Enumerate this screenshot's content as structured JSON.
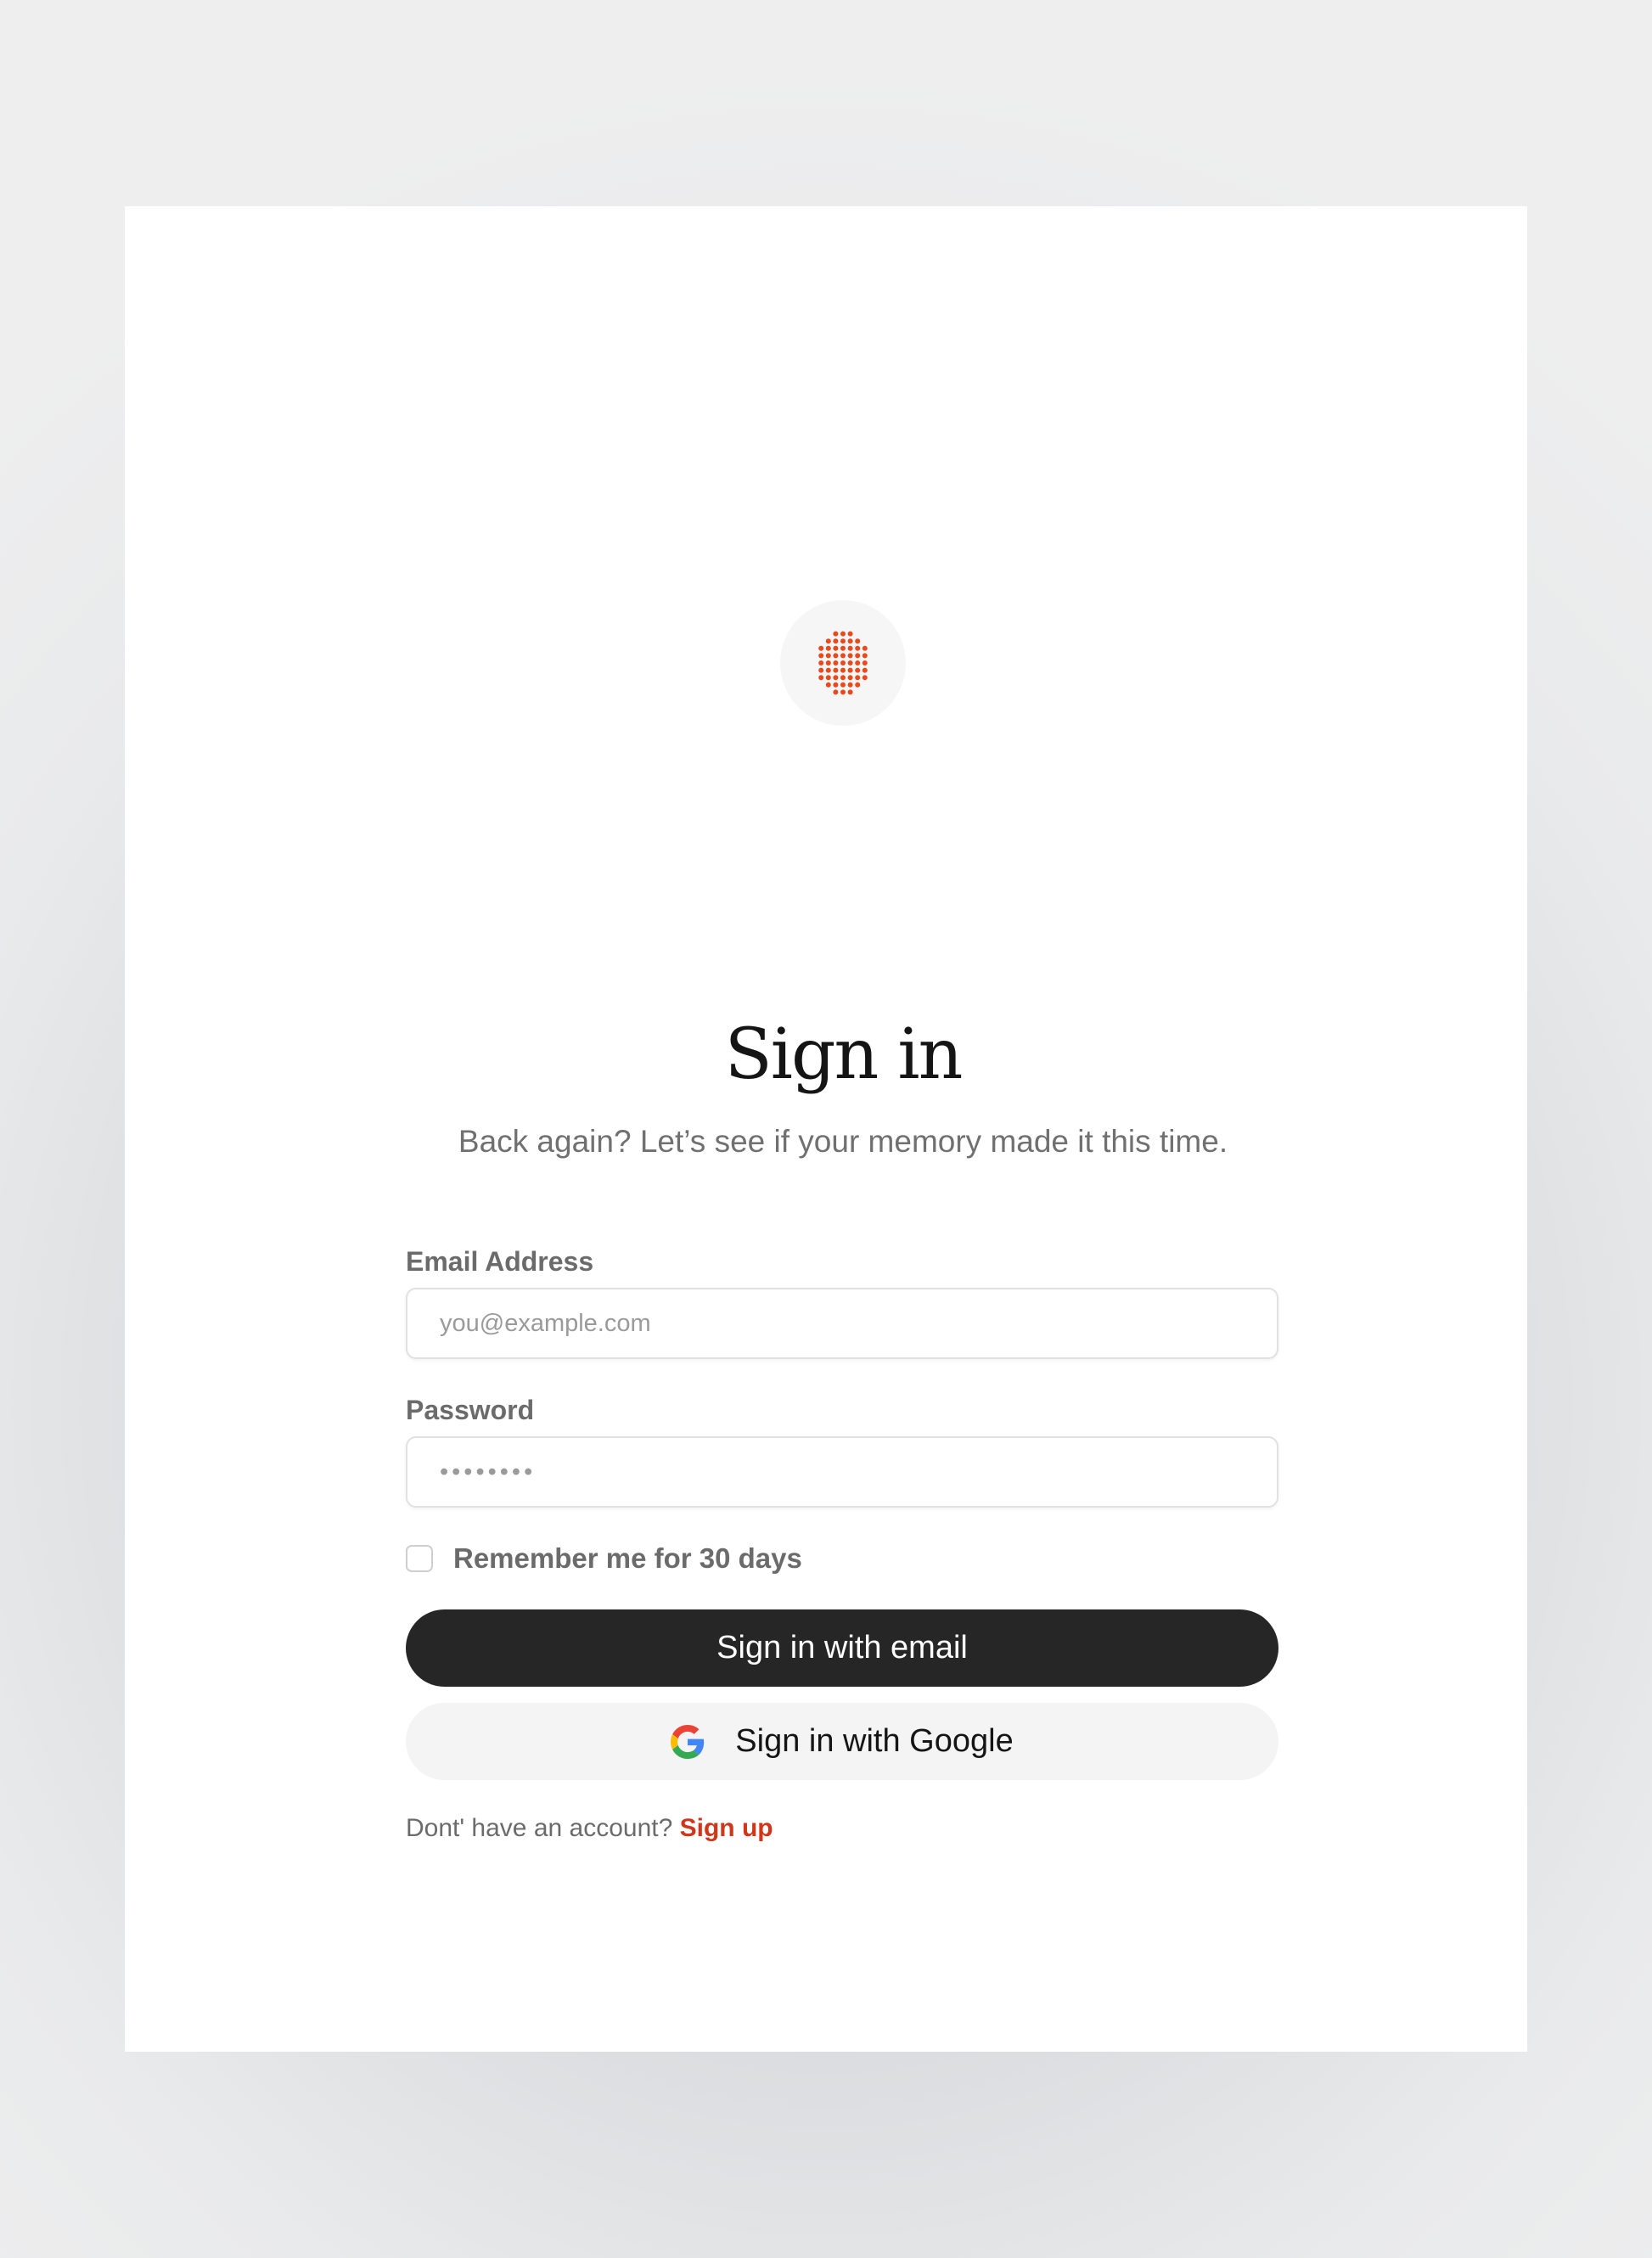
{
  "colors": {
    "accent": "#E8491D",
    "link": "#D0361A",
    "primary_button": "#262626",
    "secondary_button": "#F4F4F4"
  },
  "logo": {
    "icon": "dot-grid-logo-icon"
  },
  "header": {
    "title": "Sign in",
    "subtitle": "Back again? Let’s see if your memory made it this time."
  },
  "form": {
    "email": {
      "label": "Email Address",
      "placeholder": "you@example.com",
      "value": ""
    },
    "password": {
      "label": "Password",
      "placeholder": "••••••••",
      "value": ""
    },
    "remember": {
      "label": "Remember me for 30 days",
      "checked": false
    },
    "submit_label": "Sign in with email",
    "google_label": "Sign in with Google",
    "google_icon": "google-icon"
  },
  "footer": {
    "prompt": "Dont' have an account?",
    "link": "Sign up"
  }
}
